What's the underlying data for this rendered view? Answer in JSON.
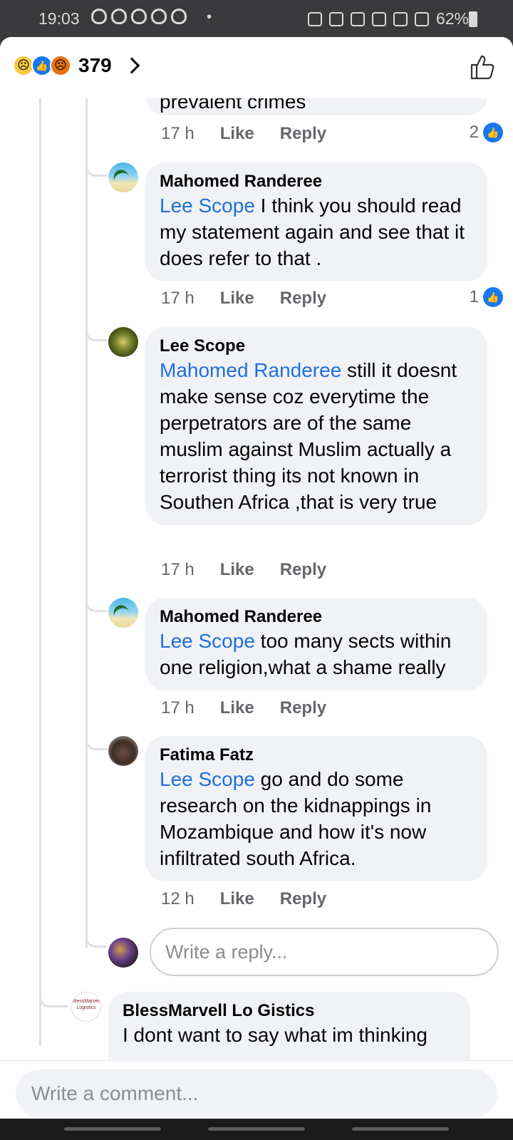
{
  "status_bar": {
    "time": "19:03",
    "dot": "•",
    "battery": "62%",
    "notification_icons": [
      "notif-icon",
      "notif-icon",
      "notif-icon",
      "notif-icon",
      "notif-icon"
    ]
  },
  "header": {
    "reaction_count": "379",
    "reactions": [
      "sad",
      "like",
      "angry"
    ]
  },
  "prev_comment": {
    "text_tail": "prevalent crimes",
    "time": "17 h",
    "like": "Like",
    "reply": "Reply",
    "likes": "2"
  },
  "comments": [
    {
      "author": "Mahomed Randeree",
      "mention": "Lee Scope",
      "text": " I think you should read my statement again and see that it does refer to that .",
      "time": "17 h",
      "like": "Like",
      "reply": "Reply",
      "likes": "1"
    },
    {
      "author": "Lee Scope",
      "mention": "Mahomed Randeree",
      "text": " still it doesnt make sense coz everytime the perpetrators are of the same muslim against Muslim actually a terrorist thing its not known in Southen Africa ,that is very true",
      "time": "17 h",
      "like": "Like",
      "reply": "Reply",
      "likes": ""
    },
    {
      "author": "Mahomed Randeree",
      "mention": "Lee Scope",
      "text": " too many sects within one religion,what a shame really",
      "time": "17 h",
      "like": "Like",
      "reply": "Reply",
      "likes": ""
    },
    {
      "author": "Fatima Fatz",
      "mention": "Lee Scope",
      "text": " go and do some research on the kidnappings in Mozambique and how it's now infiltrated south Africa.",
      "time": "12 h",
      "like": "Like",
      "reply": "Reply",
      "likes": ""
    }
  ],
  "reply_box": {
    "placeholder": "Write a reply..."
  },
  "next_comment": {
    "author": "BlessMarvell Lo Gistics",
    "text_head": "I dont want to say what im thinking",
    "avatar_text": "BlessMarvell Logistics"
  },
  "comment_box": {
    "placeholder": "Write a comment..."
  },
  "colors": {
    "mention": "#216fdb",
    "like_blue": "#1877f2",
    "bubble": "#f0f2f5"
  }
}
